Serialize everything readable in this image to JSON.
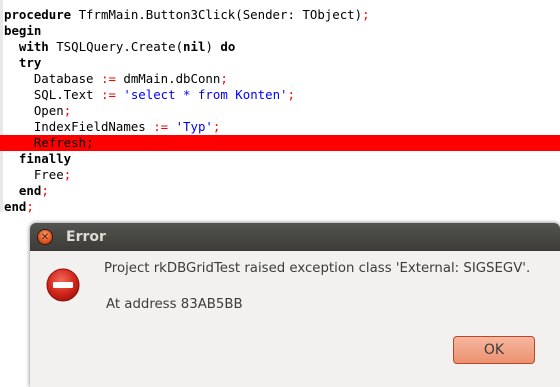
{
  "editor": {
    "lines": [
      [
        {
          "t": "procedure",
          "k": "kw"
        },
        {
          "t": " TfrmMain.Button3Click(Sender: TObject)"
        },
        {
          "t": ";",
          "k": "sym"
        }
      ],
      [
        {
          "t": "begin",
          "k": "kw"
        }
      ],
      [
        {
          "t": "  "
        },
        {
          "t": "with",
          "k": "kw"
        },
        {
          "t": " TSQLQuery.Create("
        },
        {
          "t": "nil",
          "k": "kw"
        },
        {
          "t": ") "
        },
        {
          "t": "do",
          "k": "kw"
        }
      ],
      [
        {
          "t": "  "
        },
        {
          "t": "try",
          "k": "kw"
        }
      ],
      [
        {
          "t": "    Database "
        },
        {
          "t": ":=",
          "k": "sym"
        },
        {
          "t": " dmMain.dbConn"
        },
        {
          "t": ";",
          "k": "sym"
        }
      ],
      [
        {
          "t": "    SQL.Text "
        },
        {
          "t": ":=",
          "k": "sym"
        },
        {
          "t": " "
        },
        {
          "t": "'select * from Konten'",
          "k": "str"
        },
        {
          "t": ";",
          "k": "sym"
        }
      ],
      [
        {
          "t": "    Open"
        },
        {
          "t": ";",
          "k": "sym"
        }
      ],
      [
        {
          "t": "    IndexFieldNames "
        },
        {
          "t": ":=",
          "k": "sym"
        },
        {
          "t": " "
        },
        {
          "t": "'Typ'",
          "k": "str"
        },
        {
          "t": ";",
          "k": "sym"
        }
      ],
      [
        {
          "t": "    Refresh;"
        }
      ],
      [
        {
          "t": "  "
        },
        {
          "t": "finally",
          "k": "kw"
        }
      ],
      [
        {
          "t": "    Free"
        },
        {
          "t": ";",
          "k": "sym"
        }
      ],
      [
        {
          "t": "  "
        },
        {
          "t": "end",
          "k": "kw"
        },
        {
          "t": ";",
          "k": "sym"
        }
      ],
      [
        {
          "t": "end",
          "k": "kw"
        },
        {
          "t": ";",
          "k": "sym"
        }
      ]
    ],
    "error_line_index": 8,
    "error_line_color": "#ff0000"
  },
  "dialog": {
    "title": "Error",
    "close_icon": "close-icon",
    "icon": "error-stop-icon",
    "message": "Project rkDBGridTest raised exception class 'External: SIGSEGV'.",
    "address": "At address 83AB5BB",
    "ok_label": "OK",
    "accent_color": "#ec9170"
  }
}
